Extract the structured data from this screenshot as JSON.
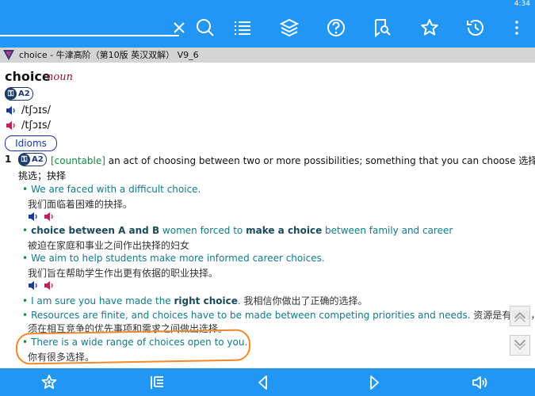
{
  "statusbar": {
    "time": "4:34"
  },
  "search": {
    "value": "",
    "placeholder": ""
  },
  "dictionary": {
    "title": "choice - 牛津高阶（第10版 英汉双解） V9_6"
  },
  "entry": {
    "headword": "choice",
    "pos": "noun",
    "level": "A2",
    "pron_uk": "/tʃɔɪs/",
    "pron_us": "/tʃɔɪs/",
    "idioms_label": "Idioms",
    "sense_number": "1",
    "sense_level": "A2",
    "grammar": "[countable]",
    "definition": "an act of choosing between two or more possibilities; something that you can choose 选择；",
    "definition_zh": "挑选；抉择",
    "examples": [
      {
        "en": "We are faced with a difficult choice.",
        "zh": "我们面临着困难的抉择。"
      },
      {
        "pattern": "choice between A and B",
        "en_pre": "women forced to ",
        "en_bold": "make a choice",
        "en_post": " between family and career",
        "zh": "被迫在家庭和事业之间作出抉择的妇女"
      },
      {
        "en": "We aim to help students make more informed career choices.",
        "zh": "我们旨在帮助学生作出更有依据的职业抉择。"
      },
      {
        "en_pre": "I am sure you have made the ",
        "en_bold": "right choice",
        "en_post": ".",
        "zh": "我相信你做出了正确的选择。"
      },
      {
        "en": "Resources are finite, and choices have to be made between competing priorities and needs.",
        "zh": "资源是有限的，必",
        "zh2": "须在相互竞争的优先事项和需求之间做出选择。"
      },
      {
        "en": "There is a wide range of choices open to you.",
        "zh": "你有很多选择。"
      }
    ]
  },
  "colors": {
    "toolbar": "#2196f3",
    "example_text": "#127a8a",
    "grammar": "#148a3c",
    "pos": "#a0102a",
    "highlight": "#f08a2a"
  },
  "icons": {
    "toolbar": [
      "close-icon",
      "search-icon",
      "list-icon",
      "layers-icon",
      "help-icon",
      "bookmark-search-icon",
      "star-icon",
      "history-icon",
      "more-icon"
    ],
    "bottom": [
      "star-add-icon",
      "toc-icon",
      "prev-icon",
      "next-icon",
      "speaker-icon"
    ]
  }
}
